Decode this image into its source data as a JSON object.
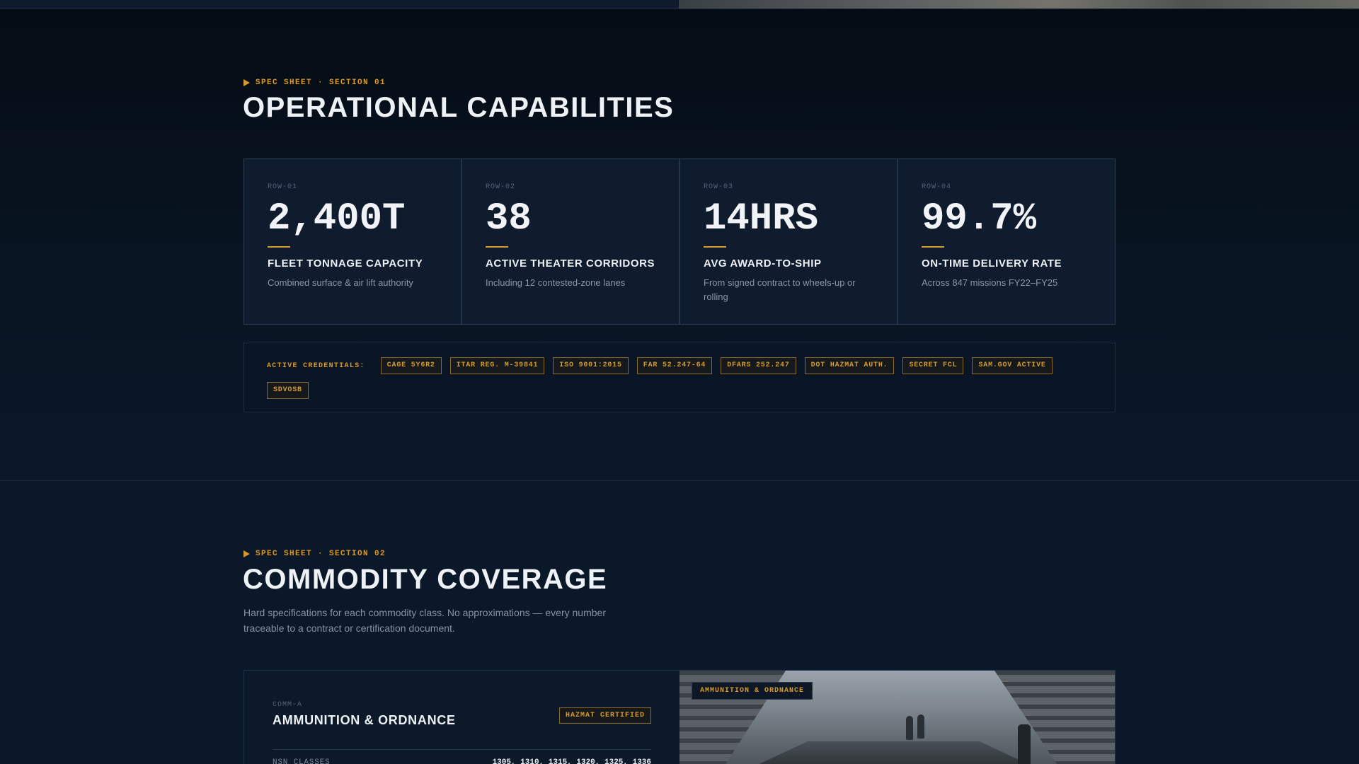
{
  "section1": {
    "eyebrow": "SPEC SHEET · SECTION 01",
    "title": "OPERATIONAL CAPABILITIES",
    "metrics": [
      {
        "row": "ROW-01",
        "value": "2,400T",
        "title": "FLEET TONNAGE CAPACITY",
        "desc": "Combined surface & air lift authority"
      },
      {
        "row": "ROW-02",
        "value": "38",
        "title": "ACTIVE THEATER CORRIDORS",
        "desc": "Including 12 contested-zone lanes"
      },
      {
        "row": "ROW-03",
        "value": "14HRS",
        "title": "AVG AWARD-TO-SHIP",
        "desc": "From signed contract to wheels-up or rolling"
      },
      {
        "row": "ROW-04",
        "value": "99.7%",
        "title": "ON-TIME DELIVERY RATE",
        "desc": "Across 847 missions FY22–FY25"
      }
    ],
    "credentials": {
      "label": "ACTIVE CREDENTIALS:",
      "tags": [
        "CAGE 5Y6R2",
        "ITAR REG. M-39841",
        "ISO 9001:2015",
        "FAR 52.247-64",
        "DFARS 252.247",
        "DOT HAZMAT AUTH.",
        "SECRET FCL",
        "SAM.GOV ACTIVE",
        "SDVOSB"
      ]
    }
  },
  "section2": {
    "eyebrow": "SPEC SHEET · SECTION 02",
    "title": "COMMODITY COVERAGE",
    "subtitle": "Hard specifications for each commodity class. No approximations — every number traceable to a contract or certification document.",
    "commodity": {
      "code": "COMM-A",
      "name": "AMMUNITION & ORDNANCE",
      "badge": "HAZMAT CERTIFIED",
      "nsn_label": "NSN CLASSES",
      "nsn_value": "1305, 1310, 1315, 1320, 1325, 1336",
      "photo_tag": "AMMUNITION & ORDNANCE"
    }
  },
  "colors": {
    "accent": "#d79a2b",
    "background": "#0b1626",
    "card": "#0f1c2e"
  }
}
